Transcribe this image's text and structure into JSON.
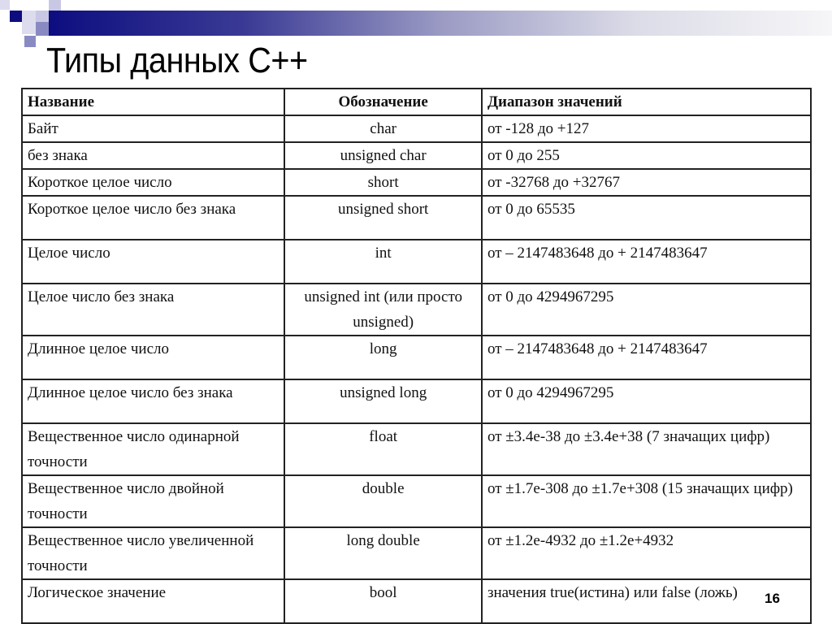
{
  "slide": {
    "title": "Типы данных С++",
    "page_number": "16",
    "colors": {
      "accent_dark": "#0d0d80",
      "accent_mid": "#8a8ac2",
      "accent_light": "#c8c8e4"
    }
  },
  "table": {
    "headers": [
      "Название",
      "Обозначение",
      "Диапазон значений"
    ],
    "rows": [
      {
        "name": "Байт",
        "type": "char",
        "range": "от -128 до +127"
      },
      {
        "name": "без знака",
        "type": "unsigned char",
        "range": "от 0 до 255"
      },
      {
        "name": "Короткое целое число",
        "type": "short",
        "range": "от -32768 до +32767"
      },
      {
        "name": "Короткое целое число без знака",
        "type": "unsigned short",
        "range": "от 0 до 65535"
      },
      {
        "name": "Целое число",
        "type": "int",
        "range": "от – 2147483648 до + 2147483647"
      },
      {
        "name": "Целое число без знака",
        "type": "unsigned int (или просто unsigned)",
        "range": "от 0 до 4294967295"
      },
      {
        "name": "Длинное целое число",
        "type": "long",
        "range": "от – 2147483648 до + 2147483647"
      },
      {
        "name": "Длинное целое число без знака",
        "type": "unsigned long",
        "range": "от 0 до 4294967295"
      },
      {
        "name": "Вещественное число одинарной точности",
        "type": "float",
        "range": "от ±3.4e-38 до ±3.4e+38 (7 значащих цифр)"
      },
      {
        "name": "Вещественное число двойной точности",
        "type": "double",
        "range": "от ±1.7e-308 до ±1.7e+308 (15 значащих цифр)"
      },
      {
        "name": "Вещественное число увеличенной точности",
        "type": "long double",
        "range": "от ±1.2e-4932 до ±1.2e+4932"
      },
      {
        "name": "Логическое значение",
        "type": "bool",
        "range": "значения true(истина) или false (ложь)"
      }
    ]
  }
}
